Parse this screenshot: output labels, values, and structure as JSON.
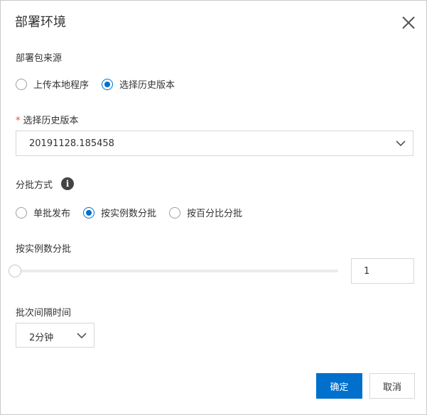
{
  "dialog": {
    "title": "部署环境"
  },
  "source": {
    "label": "部署包来源",
    "options": [
      {
        "label": "上传本地程序",
        "selected": false
      },
      {
        "label": "选择历史版本",
        "selected": true
      }
    ]
  },
  "history": {
    "label": "选择历史版本",
    "required_mark": "*",
    "value": "20191128.185458"
  },
  "batch_mode": {
    "label": "分批方式",
    "options": [
      {
        "label": "单批发布",
        "selected": false
      },
      {
        "label": "按实例数分批",
        "selected": true
      },
      {
        "label": "按百分比分批",
        "selected": false
      }
    ]
  },
  "instance_batch": {
    "label": "按实例数分批",
    "value": "1",
    "slider_level": 0
  },
  "interval": {
    "label": "批次间隔时间",
    "value": "2分钟"
  },
  "footer": {
    "confirm_label": "确定",
    "cancel_label": "取消"
  },
  "colors": {
    "primary": "#0070cc",
    "required": "#e64b3c"
  },
  "icons": {
    "close": "close-icon",
    "info": "info-icon",
    "dropdown": "chevron-down-icon"
  }
}
